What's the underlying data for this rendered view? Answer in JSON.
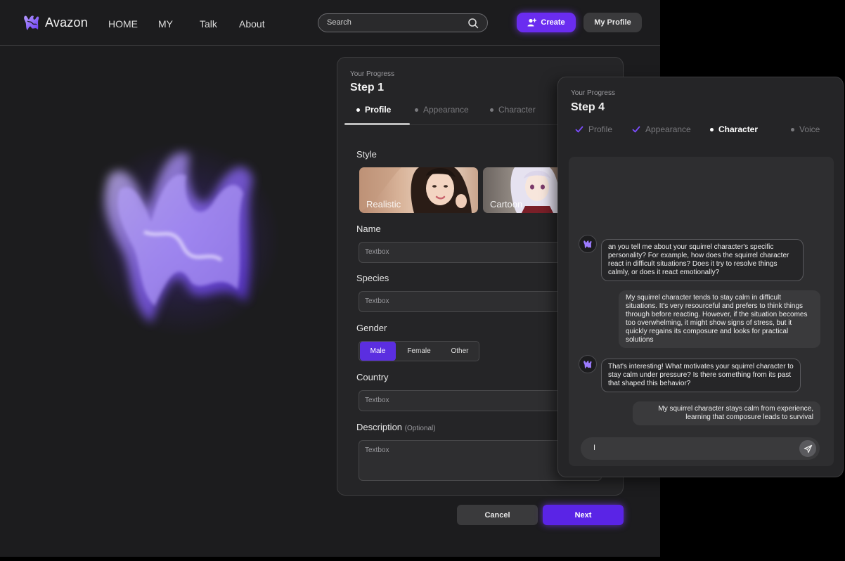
{
  "app": {
    "brand": "Avazon",
    "nav": [
      "HOME",
      "MY",
      "Talk",
      "About"
    ],
    "search_placeholder": "Search",
    "create_label": "Create",
    "profile_label": "My Profile"
  },
  "colors": {
    "background": "#1c1c1e",
    "card": "#252527",
    "accent": "#6a2cf0",
    "accent_glow": "#7c3aff"
  },
  "step1": {
    "progress_label": "Your Progress",
    "title": "Step 1",
    "tabs": [
      {
        "label": "Profile",
        "state": "active"
      },
      {
        "label": "Appearance",
        "state": "inactive"
      },
      {
        "label": "Character",
        "state": "inactive"
      }
    ],
    "style_label": "Style",
    "styles": [
      {
        "label": "Realistic",
        "icon": "portrait-woman-image"
      },
      {
        "label": "Cartoon",
        "icon": "anime-character-image"
      }
    ],
    "name_label": "Name",
    "name_value": "Textbox",
    "species_label": "Species",
    "species_value": "Textbox",
    "gender_label": "Gender",
    "gender_options": [
      "Male",
      "Female",
      "Other"
    ],
    "gender_selected": "Male",
    "country_label": "Country",
    "country_value": "Textbox",
    "description_label": "Description",
    "description_optional": "(Optional)",
    "description_value": "Textbox",
    "cancel_label": "Cancel",
    "next_label": "Next"
  },
  "step4": {
    "progress_label": "Your Progress",
    "title": "Step 4",
    "tabs": [
      {
        "label": "Profile",
        "state": "done"
      },
      {
        "label": "Appearance",
        "state": "done"
      },
      {
        "label": "Character",
        "state": "active"
      },
      {
        "label": "Voice",
        "state": "inactive"
      }
    ],
    "messages": [
      {
        "role": "bot",
        "text": "an you tell me about your squirrel character's specific personality? For example, how does the squirrel character react in difficult situations? Does it try to resolve things calmly, or does it react emotionally?"
      },
      {
        "role": "user",
        "text": "My squirrel character tends to stay calm in difficult situations. It's very resourceful and prefers to think things through before reacting. However, if the situation becomes too overwhelming, it might show signs of stress, but it quickly regains its composure and looks for practical solutions"
      },
      {
        "role": "bot",
        "text": "That's interesting! What motivates your squirrel character to stay calm under pressure? Is there something from its past that shaped this behavior?"
      },
      {
        "role": "user",
        "text": "My squirrel character stays calm from experience, learning that composure leads to survival"
      }
    ],
    "input_value": "I"
  }
}
